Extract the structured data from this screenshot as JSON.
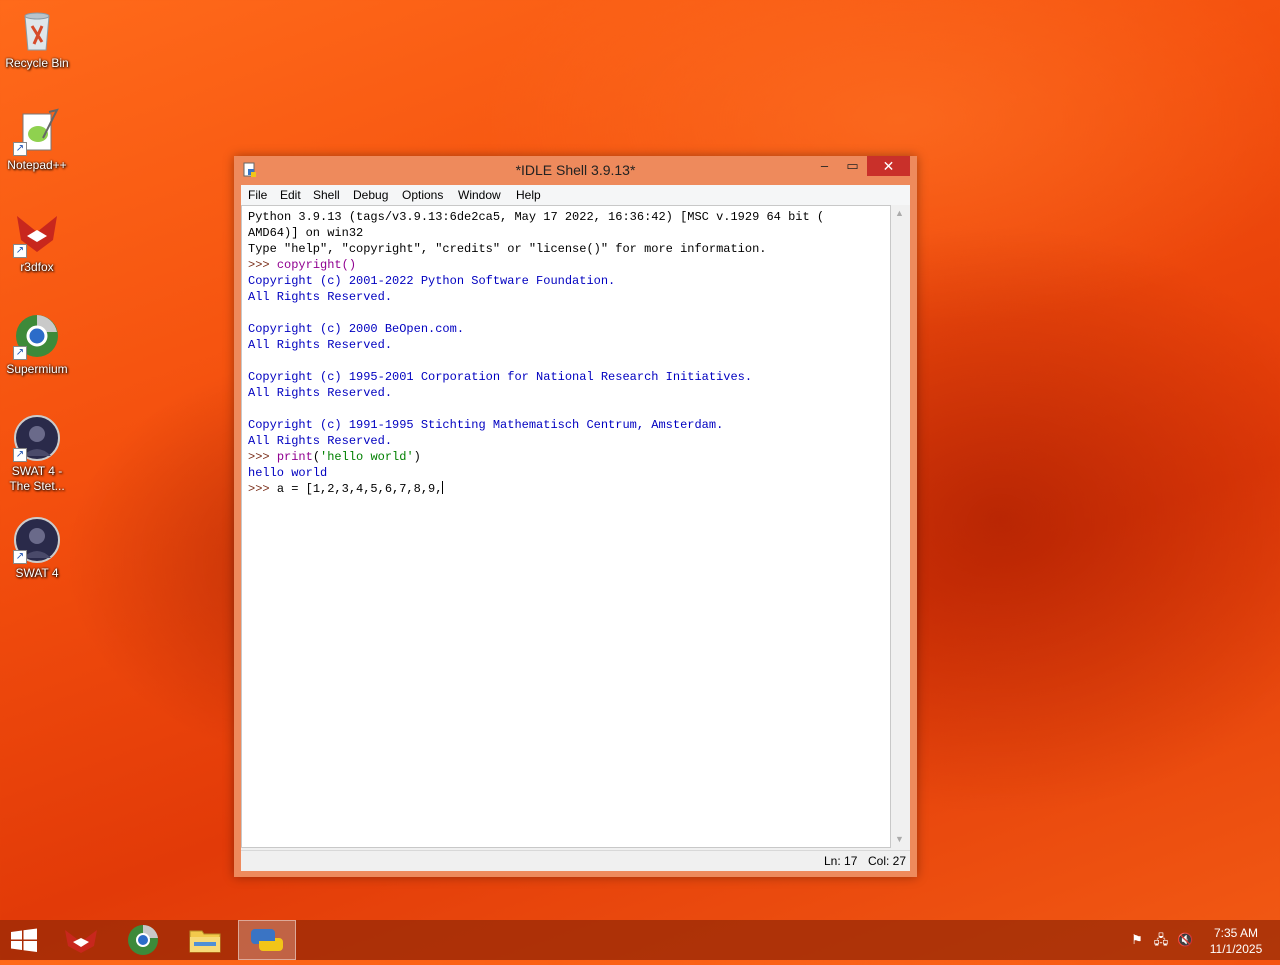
{
  "desktop": {
    "icons": [
      {
        "label": "Recycle Bin"
      },
      {
        "label": "Notepad++"
      },
      {
        "label": "r3dfox"
      },
      {
        "label": "Supermium"
      },
      {
        "label": "SWAT 4 -\nThe Stet..."
      },
      {
        "label": "SWAT 4"
      }
    ]
  },
  "window": {
    "title": "*IDLE Shell 3.9.13*",
    "controls": {
      "minimize": "–",
      "maximize": "▭",
      "close": "✕"
    },
    "menu": [
      "File",
      "Edit",
      "Shell",
      "Debug",
      "Options",
      "Window",
      "Help"
    ],
    "shell": {
      "banner1": "Python 3.9.13 (tags/v3.9.13:6de2ca5, May 17 2022, 16:36:42) [MSC v.1929 64 bit (",
      "banner2": "AMD64)] on win32",
      "banner3": "Type \"help\", \"copyright\", \"credits\" or \"license()\" for more information.",
      "prompt": ">>> ",
      "cmd1": "copyright()",
      "copyright": [
        "Copyright (c) 2001-2022 Python Software Foundation.",
        "All Rights Reserved.",
        "",
        "Copyright (c) 2000 BeOpen.com.",
        "All Rights Reserved.",
        "",
        "Copyright (c) 1995-2001 Corporation for National Research Initiatives.",
        "All Rights Reserved.",
        "",
        "Copyright (c) 1991-1995 Stichting Mathematisch Centrum, Amsterdam.",
        "All Rights Reserved."
      ],
      "cmd2_func": "print",
      "cmd2_open": "(",
      "cmd2_str": "'hello world'",
      "cmd2_close": ")",
      "output2": "hello world",
      "cmd3": "a = [1,2,3,4,5,6,7,8,9,"
    },
    "status": {
      "line": "Ln: 17",
      "col": "Col: 27"
    }
  },
  "taskbar": {
    "pinned": [
      "start-button",
      "r3dfox",
      "supermium",
      "file-explorer",
      "idle-python"
    ],
    "active": "idle-python",
    "clock_time": "7:35 AM",
    "clock_date": "11/1/2025"
  }
}
